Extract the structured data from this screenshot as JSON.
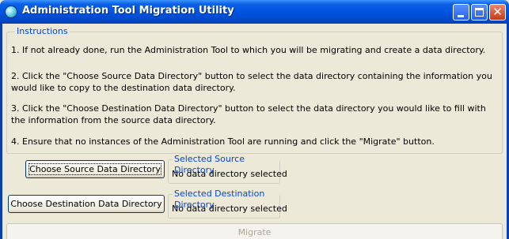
{
  "window": {
    "title": "Administration Tool Migration Utility"
  },
  "instructions": {
    "legend": "Instructions",
    "steps": [
      "1. If not already done, run the Administration Tool to which you will be migrating and create a data directory.",
      "2. Click the \"Choose Source Data Directory\" button to select the data directory containing the information you would like to copy to the destination data directory.",
      "3. Click the \"Choose Destination Data Directory\" button to select the data directory you would like to fill with the information from the source data directory.",
      "4. Ensure that no instances of the Administration Tool are running and click the \"Migrate\" button."
    ]
  },
  "source": {
    "button_label": "Choose Source Data Directory",
    "group_label": "Selected Source Directory",
    "value": "No data directory selected"
  },
  "destination": {
    "button_label": "Choose Destination Data Directory",
    "group_label": "Selected Destination Directory",
    "value": "No data directory selected"
  },
  "migrate_label": "Migrate",
  "icons": {
    "app": "app-globe-icon",
    "minimize": "minimize-icon",
    "maximize": "maximize-icon",
    "close": "close-icon"
  },
  "colors": {
    "titlebar": "#0054e3",
    "legend_text": "#0046d5",
    "close_button": "#c23b1b",
    "disabled_text": "#aca899"
  }
}
